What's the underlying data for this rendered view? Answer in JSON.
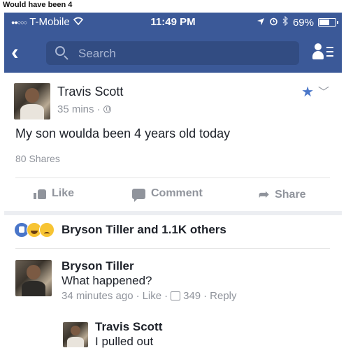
{
  "caption": "Would have been 4",
  "statusbar": {
    "carrier": "T-Mobile",
    "time": "11:49 PM",
    "battery": "69%",
    "battery_level": 0.69
  },
  "navbar": {
    "back_icon": "chevron-left-icon",
    "search_placeholder": "Search",
    "friends_icon": "friend-requests-icon"
  },
  "post": {
    "author": "Travis Scott",
    "time": "35 mins",
    "text": "My son woulda been 4 years old today",
    "shares": "80 Shares",
    "actions": {
      "like": "Like",
      "comment": "Comment",
      "share": "Share"
    }
  },
  "reactions": {
    "summary": "Bryson Tiller and 1.1K others"
  },
  "comments": [
    {
      "author": "Bryson Tiller",
      "text": "What happened?",
      "time": "34 minutes ago",
      "like": "Like",
      "like_count": "349",
      "reply": "Reply"
    }
  ],
  "reply": {
    "author": "Travis Scott",
    "text": "I pulled out"
  },
  "colors": {
    "brand": "#3b5998",
    "text": "#1d2129",
    "muted": "#90949c"
  }
}
